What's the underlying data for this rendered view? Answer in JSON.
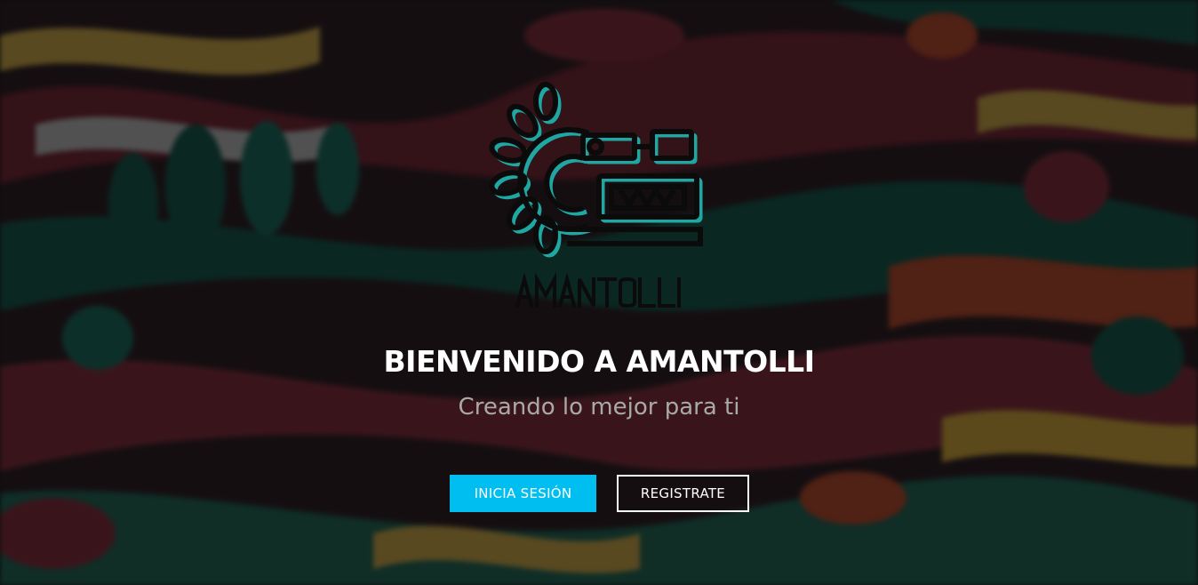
{
  "brand": {
    "logo_text": "AMANTOLLI"
  },
  "hero": {
    "headline": "BIENVENIDO A AMANTOLLI",
    "subtitle": "Creando lo mejor para ti"
  },
  "actions": {
    "login_label": "INICIA SESIÓN",
    "register_label": "REGISTRATE"
  },
  "colors": {
    "accent": "#00bff0",
    "logo_teal": "#1fa7a3",
    "logo_dark": "#0b0b0b"
  }
}
